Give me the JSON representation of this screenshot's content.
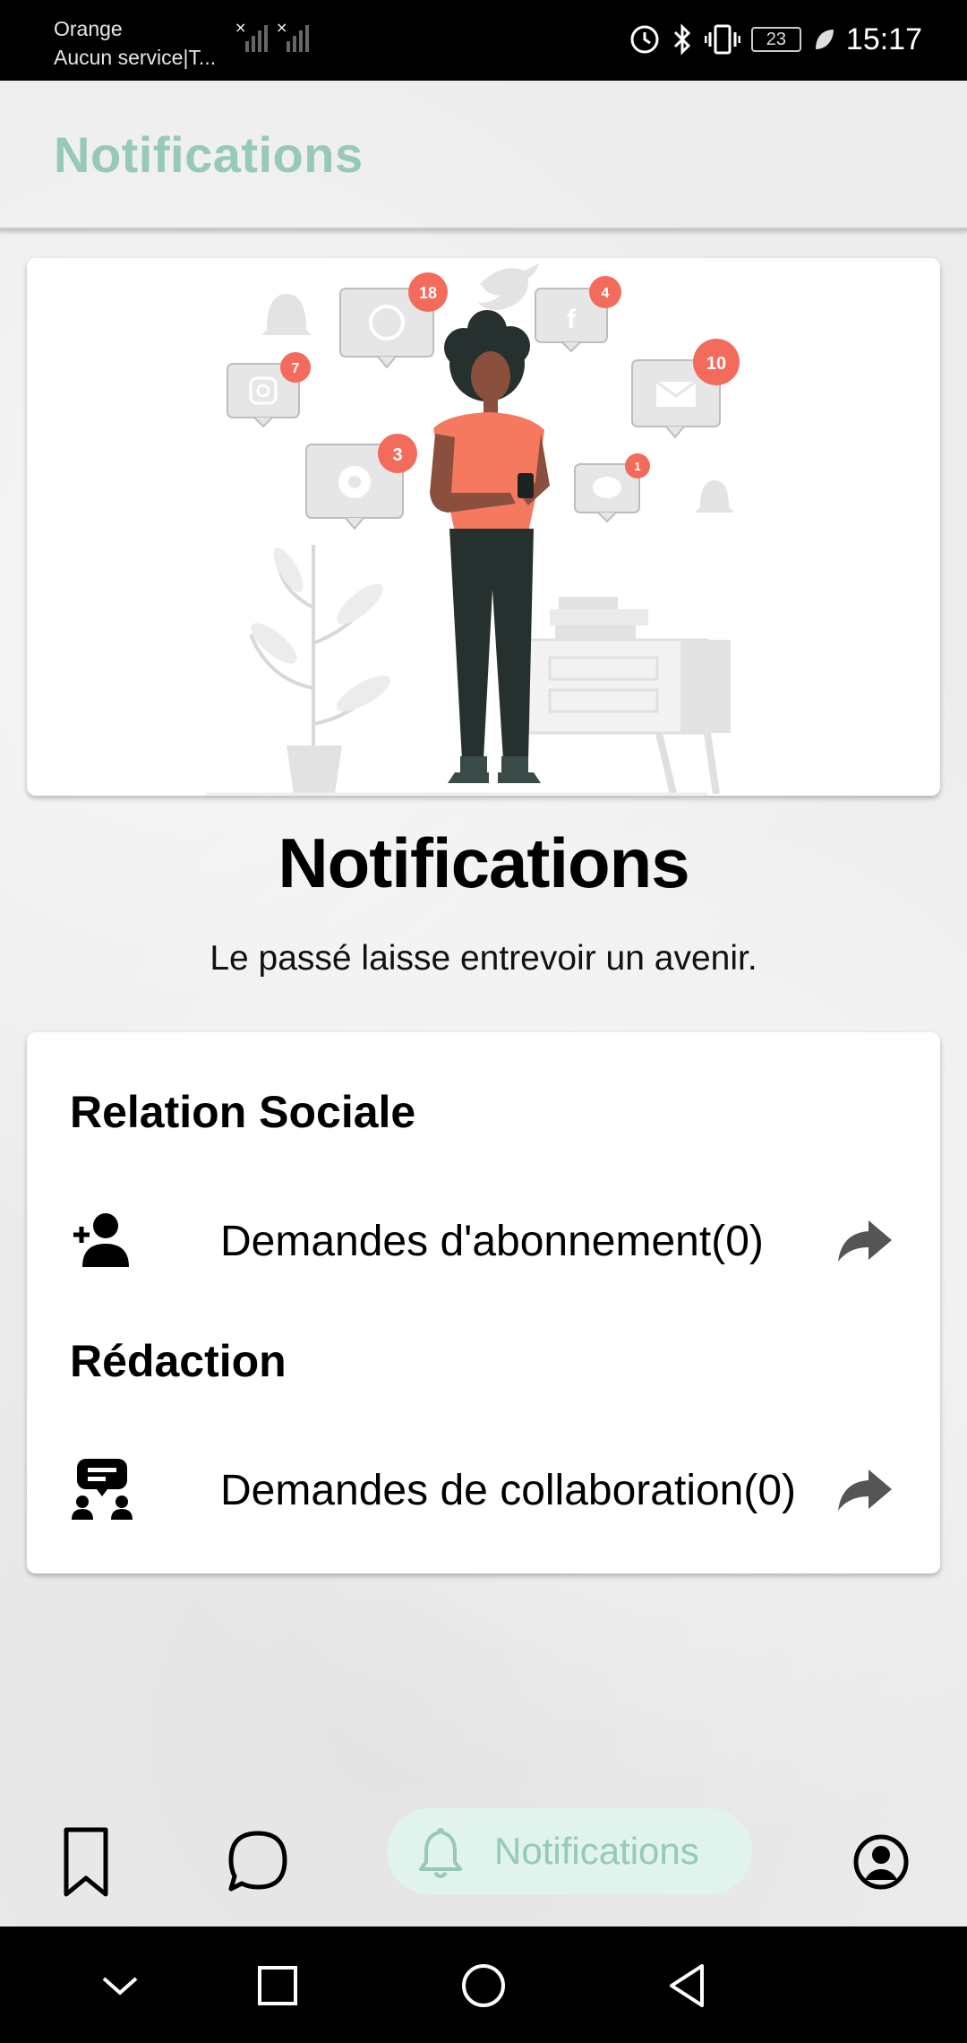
{
  "status_bar": {
    "carrier_name": "Orange",
    "carrier_service": "Aucun service|T...",
    "battery_level": "23",
    "time": "15:17"
  },
  "header": {
    "title": "Notifications"
  },
  "illustration": {
    "badges": [
      "18",
      "4",
      "7",
      "10",
      "3",
      "1"
    ]
  },
  "hero": {
    "title": "Notifications",
    "subtitle": "Le passé laisse entrevoir un avenir."
  },
  "sections": [
    {
      "title": "Relation Sociale",
      "item_label": "Demandes d'abonnement(0)",
      "icon": "person-add-icon"
    },
    {
      "title": "Rédaction",
      "item_label": "Demandes de collaboration(0)",
      "icon": "collaboration-icon"
    }
  ],
  "bottom_nav": {
    "items": [
      "bookmark-icon",
      "chat-icon",
      "bell-icon",
      "account-icon"
    ],
    "active_label": "Notifications"
  },
  "colors": {
    "accent": "#96c9b8",
    "accent_bg": "#e0f3ec",
    "badge": "#f26b5b",
    "shirt": "#f4795f"
  }
}
